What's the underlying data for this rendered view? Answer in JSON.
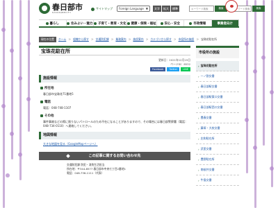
{
  "header": {
    "logo_jp": "春日部市",
    "logo_en": "KASUKABECITY",
    "sitemap": "サイトマップ",
    "language": "Foreign Language",
    "fontsize": [
      "文字",
      "拡大",
      "標準"
    ],
    "search_placeholder": "キーワード検索",
    "search_button": "検索",
    "search2_placeholder": "キーワード検索",
    "search2_button": "検索"
  },
  "nav": {
    "items": [
      "暮らし",
      "住みよい・魅力",
      "子育て・教育・文化",
      "健康・保険・福祉",
      "安心・安全",
      "市政情報",
      "事業者向け"
    ]
  },
  "breadcrumb": {
    "here": "現在の位置",
    "items": [
      "ホーム",
      "組織から探す",
      "交通防犯課",
      "業務案内",
      "施設案内",
      "カテゴリから探す",
      "市役所の施設",
      "宝珠花駐在所"
    ]
  },
  "main": {
    "title": "宝珠花駐在所",
    "updated": "更新日：2021年12月19日",
    "page_id": "ページID：8532",
    "share": [
      "Facebook",
      "Twitter",
      "LINE"
    ],
    "facility_heading": "施設情報",
    "address_heading": "所在地",
    "address": "春日部市宝珠花71番地5",
    "phone_heading": "電話",
    "phone": "電話：048-748-1107",
    "other_heading": "その他",
    "other_text": "事件事故などの際に限りないパトロールのため不在になることがありますので、その場合には春日部警察署（電話：048-734-0110）へ連絡してください。",
    "map_heading": "地図情報",
    "map_link": "大きな地図を見る（GoogleMapページへ）",
    "inquiry_title": "この記事に関するお問い合わせ先",
    "inquiry_lines": [
      "交通防犯課 防犯・消費生活担当",
      "所在地：〒344-8577 春日部市中央七丁目2番地1",
      "電話：048-736-1111（代表）"
    ]
  },
  "sidebar": {
    "heading": "市役所の施設",
    "items": [
      "宝珠花駐在所",
      "一ノ割交番",
      "春日部駅交番",
      "春日部駅東口交番",
      "春日部駅西口交番",
      "豊春交番",
      "藤塚・大枝交番",
      "庄和駐在所",
      "武里交番",
      "豊野駐在所",
      "南桜井交番",
      "牛島交番"
    ]
  }
}
